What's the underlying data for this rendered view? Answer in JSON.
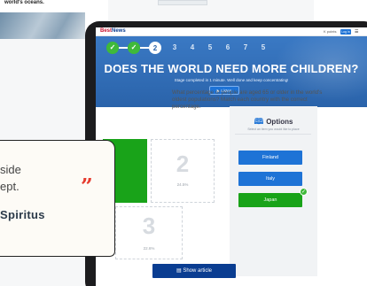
{
  "background_page": {
    "caption": "world's oceans."
  },
  "app": {
    "logo_first": "Best",
    "logo_second": "News",
    "top_link": "K points",
    "top_button": "Log in",
    "menu_glyph": "☰"
  },
  "progress": {
    "steps": [
      {
        "label": "✓",
        "state": "done"
      },
      {
        "label": "✓",
        "state": "done"
      },
      {
        "label": "2",
        "state": "current"
      },
      {
        "label": "3",
        "state": "todo"
      },
      {
        "label": "4",
        "state": "todo"
      },
      {
        "label": "5",
        "state": "todo"
      },
      {
        "label": "6",
        "state": "todo"
      },
      {
        "label": "7",
        "state": "todo"
      },
      {
        "label": "5",
        "state": "todo"
      }
    ]
  },
  "hero": {
    "title": "DOES THE WORLD NEED MORE CHILDREN?",
    "subtitle": "Stage completed in 1 minute. Well done and keep concentrating!",
    "listen_label": "▶ Listen"
  },
  "question": {
    "text": "What percentage of people are aged 65 or older in the world's oldest populations? Match each country with the correct percentage."
  },
  "options": {
    "title": "Options",
    "book_icon": "book-icon",
    "help_text": "Select an item you would like to place",
    "items": [
      {
        "label": "Finland",
        "state": "default"
      },
      {
        "label": "Italy",
        "state": "default"
      },
      {
        "label": "Japan",
        "state": "correct"
      }
    ],
    "check_glyph": "✓"
  },
  "tiles": [
    {
      "number": "2",
      "percent": "24.5%"
    },
    {
      "number": "3",
      "percent": "22.6%"
    }
  ],
  "show_article_label": "▤ Show article",
  "quote": {
    "line1": "side",
    "line2": "ept.",
    "mark": "”",
    "author": "Spiritus"
  },
  "colors": {
    "accent_blue": "#1e73d6",
    "correct_green": "#19a319",
    "hero_blue": "#2a63aa",
    "quote_red": "#e63b2e"
  }
}
